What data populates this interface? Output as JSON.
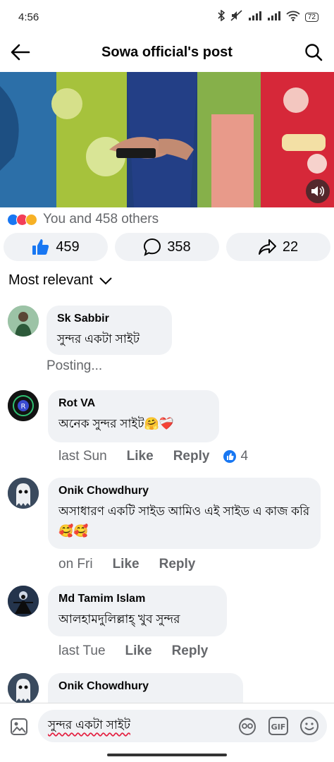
{
  "status_bar": {
    "time": "4:56",
    "battery": "72"
  },
  "header": {
    "title": "Sowa official's post",
    "back_icon": "back-arrow-icon",
    "search_icon": "search-icon"
  },
  "post": {
    "reactions_text": "You and 458 others",
    "like_count": "459",
    "comment_count": "358",
    "share_count": "22"
  },
  "sort_label": "Most relevant",
  "comments": [
    {
      "name": "Sk Sabbir",
      "text": "সুন্দর একটা সাইট",
      "status": "Posting..."
    },
    {
      "name": "Rot VA",
      "text": "অনেক সুন্দর সাইট🤗❤️‍🩹",
      "time": "last Sun",
      "like": "Like",
      "reply": "Reply",
      "likes": "4"
    },
    {
      "name": "Onik Chowdhury",
      "text": "অসাধারণ একটি সাইড আমিও এই সাইড এ কাজ করি 🥰🥰",
      "time": "on Fri",
      "like": "Like",
      "reply": "Reply"
    },
    {
      "name": "Md Tamim Islam",
      "text": "আলহামদুলিল্লাহ্‌ খুব সুন্দর",
      "time": "last Tue",
      "like": "Like",
      "reply": "Reply"
    },
    {
      "name": "Onik Chowdhury"
    }
  ],
  "composer": {
    "text": "সুন্দর একটা সাইট"
  },
  "colors": {
    "accent": "#1877f2",
    "bubble": "#f0f2f5",
    "muted": "#65676b"
  }
}
